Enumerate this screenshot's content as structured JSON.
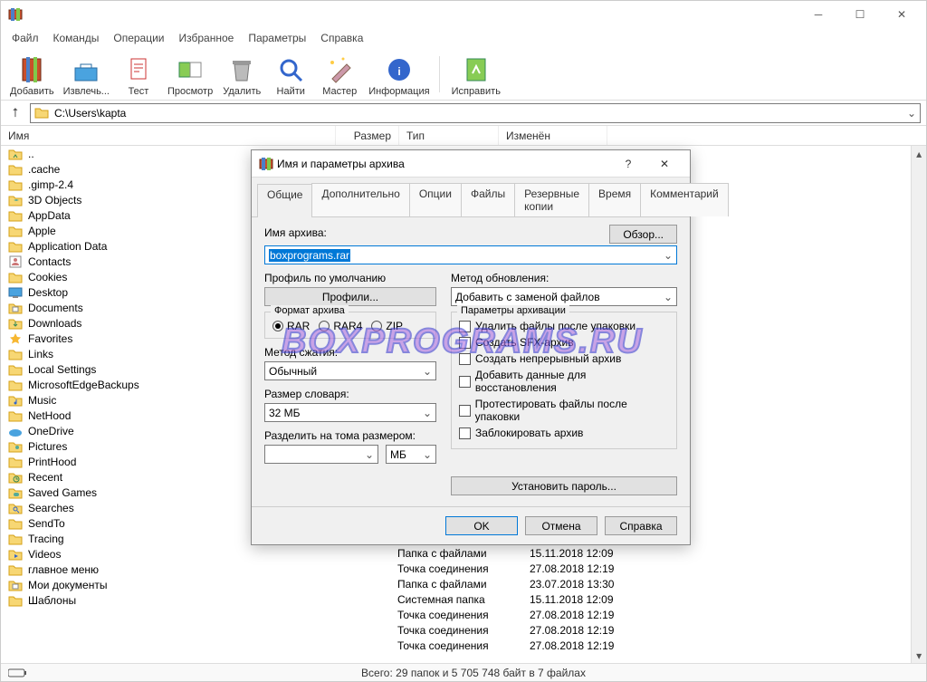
{
  "menus": [
    "Файл",
    "Команды",
    "Операции",
    "Избранное",
    "Параметры",
    "Справка"
  ],
  "toolbar": [
    {
      "label": "Добавить"
    },
    {
      "label": "Извлечь..."
    },
    {
      "label": "Тест"
    },
    {
      "label": "Просмотр"
    },
    {
      "label": "Удалить"
    },
    {
      "label": "Найти"
    },
    {
      "label": "Мастер"
    },
    {
      "label": "Информация"
    },
    {
      "sep": true
    },
    {
      "label": "Исправить"
    }
  ],
  "address": "C:\\Users\\kapta",
  "columns": {
    "name": "Имя",
    "size": "Размер",
    "type": "Тип",
    "mod": "Изменён"
  },
  "files": [
    {
      "name": "..",
      "icon": "up"
    },
    {
      "name": ".cache",
      "icon": "folder"
    },
    {
      "name": ".gimp-2.4",
      "icon": "folder"
    },
    {
      "name": "3D Objects",
      "icon": "folder-3d"
    },
    {
      "name": "AppData",
      "icon": "folder"
    },
    {
      "name": "Apple",
      "icon": "folder"
    },
    {
      "name": "Application Data",
      "icon": "folder"
    },
    {
      "name": "Contacts",
      "icon": "contacts"
    },
    {
      "name": "Cookies",
      "icon": "folder"
    },
    {
      "name": "Desktop",
      "icon": "desktop"
    },
    {
      "name": "Documents",
      "icon": "documents"
    },
    {
      "name": "Downloads",
      "icon": "downloads"
    },
    {
      "name": "Favorites",
      "icon": "favorites"
    },
    {
      "name": "Links",
      "icon": "folder"
    },
    {
      "name": "Local Settings",
      "icon": "folder"
    },
    {
      "name": "MicrosoftEdgeBackups",
      "icon": "folder"
    },
    {
      "name": "Music",
      "icon": "music"
    },
    {
      "name": "NetHood",
      "icon": "folder"
    },
    {
      "name": "OneDrive",
      "icon": "onedrive"
    },
    {
      "name": "Pictures",
      "icon": "pictures"
    },
    {
      "name": "PrintHood",
      "icon": "folder"
    },
    {
      "name": "Recent",
      "icon": "recent"
    },
    {
      "name": "Saved Games",
      "icon": "games"
    },
    {
      "name": "Searches",
      "icon": "searches"
    },
    {
      "name": "SendTo",
      "icon": "folder"
    },
    {
      "name": "Tracing",
      "icon": "folder"
    },
    {
      "name": "Videos",
      "icon": "videos"
    },
    {
      "name": "главное меню",
      "icon": "folder"
    },
    {
      "name": "Мои документы",
      "icon": "documents"
    },
    {
      "name": "Шаблоны",
      "icon": "folder"
    }
  ],
  "detail_rows": [
    {
      "type": "Папка с файлами",
      "mod": "15.11.2018 12:09"
    },
    {
      "type": "Папка с файлами",
      "mod": "15.11.2018 12:09"
    },
    {
      "type": "Точка соединения",
      "mod": "27.08.2018 12:19"
    },
    {
      "type": "Папка с файлами",
      "mod": "23.07.2018 13:30"
    },
    {
      "type": "Системная папка",
      "mod": "15.11.2018 12:09"
    },
    {
      "type": "Точка соединения",
      "mod": "27.08.2018 12:19"
    },
    {
      "type": "Точка соединения",
      "mod": "27.08.2018 12:19"
    },
    {
      "type": "Точка соединения",
      "mod": "27.08.2018 12:19"
    }
  ],
  "status": "Всего: 29 папок и 5 705 748 байт в 7 файлах",
  "dialog": {
    "title": "Имя и параметры архива",
    "tabs": [
      "Общие",
      "Дополнительно",
      "Опции",
      "Файлы",
      "Резервные копии",
      "Время",
      "Комментарий"
    ],
    "archive_name_label": "Имя архива:",
    "archive_name": "boxprograms.rar",
    "browse": "Обзор...",
    "profile_label": "Профиль по умолчанию",
    "profile_btn": "Профили...",
    "update_label": "Метод обновления:",
    "update_value": "Добавить с заменой файлов",
    "format_label": "Формат архива",
    "formats": [
      "RAR",
      "RAR4",
      "ZIP"
    ],
    "compress_label": "Метод сжатия:",
    "compress_value": "Обычный",
    "dict_label": "Размер словаря:",
    "dict_value": "32 МБ",
    "split_label": "Разделить на тома размером:",
    "split_unit": "МБ",
    "params_label": "Параметры архивации",
    "checks": [
      "Удалить файлы после упаковки",
      "Создать SFX-архив",
      "Создать непрерывный архив",
      "Добавить данные для восстановления",
      "Протестировать файлы после упаковки",
      "Заблокировать архив"
    ],
    "password_btn": "Установить пароль...",
    "ok": "OK",
    "cancel": "Отмена",
    "help": "Справка"
  },
  "watermark": "BOXPROGRAMS.RU"
}
